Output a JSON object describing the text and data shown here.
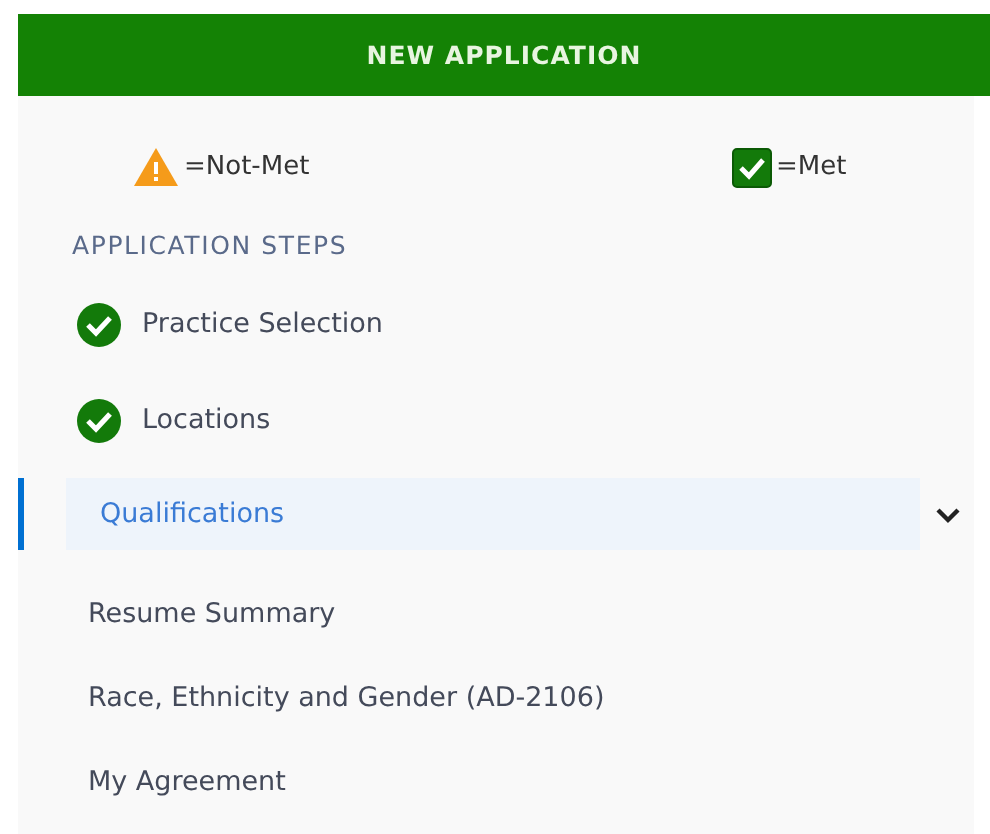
{
  "header": {
    "title": "NEW APPLICATION"
  },
  "legend": [
    {
      "kind": "warning",
      "label": "=Not-Met"
    },
    {
      "kind": "met",
      "label": "=Met"
    }
  ],
  "steps_heading": "APPLICATION STEPS",
  "steps": [
    {
      "label": "Practice Selection",
      "kind": "complete",
      "selected": false
    },
    {
      "label": "Locations",
      "kind": "complete",
      "selected": false
    },
    {
      "label": "Qualifications",
      "kind": "section",
      "selected": true,
      "expanded": true,
      "children": [
        {
          "label": "Resume Summary"
        },
        {
          "label": "Race, Ethnicity and Gender (AD-2106)"
        },
        {
          "label": "My Agreement"
        }
      ]
    }
  ]
}
